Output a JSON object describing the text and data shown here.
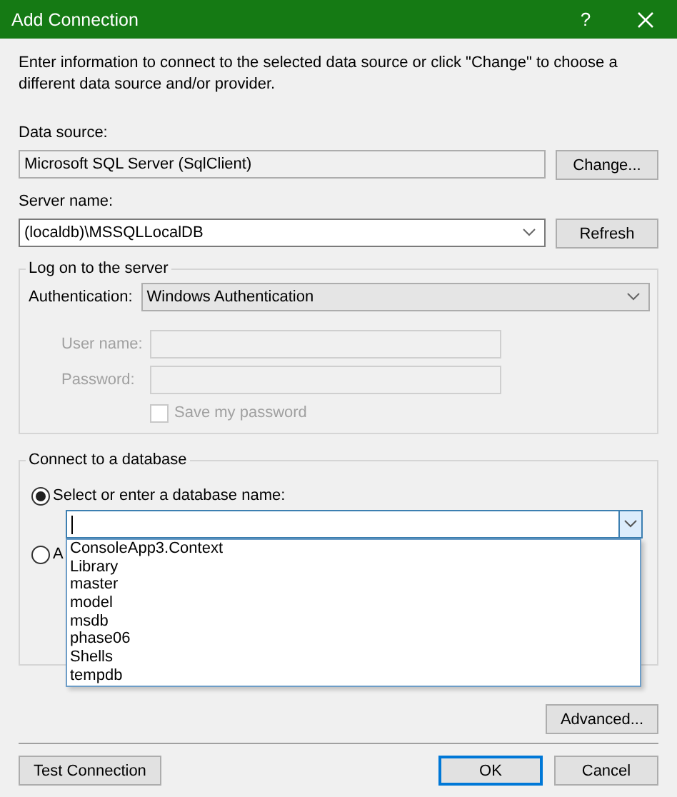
{
  "window": {
    "title": "Add Connection",
    "help": "?"
  },
  "intro": "Enter information to connect to the selected data source or click \"Change\" to choose a different data source and/or provider.",
  "data_source": {
    "label": "Data source:",
    "value": "Microsoft SQL Server (SqlClient)",
    "button": "Change..."
  },
  "server_name": {
    "label": "Server name:",
    "value": "(localdb)\\MSSQLLocalDB",
    "button": "Refresh"
  },
  "logon": {
    "title": "Log on to the server",
    "authentication": {
      "label": "Authentication:",
      "value": "Windows Authentication"
    },
    "fields": [
      {
        "label": "User name:",
        "disabled": true
      },
      {
        "label": "Password:",
        "disabled": true
      }
    ],
    "save_password": {
      "label": "Save my password",
      "checked": false,
      "disabled": true
    }
  },
  "database": {
    "title": "Connect to a database",
    "options": [
      {
        "label": "Select or enter a database name:",
        "selected": true
      },
      {
        "label": "A",
        "selected": false
      }
    ],
    "combo": {
      "expanded": true,
      "items": [
        {
          "label": "ConsoleApp3.Context"
        },
        {
          "label": "Library"
        },
        {
          "label": "master"
        },
        {
          "label": "model"
        },
        {
          "label": "msdb"
        },
        {
          "label": "phase06"
        },
        {
          "label": "Shells"
        },
        {
          "label": "tempdb"
        }
      ]
    }
  },
  "advanced_button": "Advanced...",
  "buttons": [
    {
      "label": "Test Connection",
      "default": false
    },
    {
      "label": "OK",
      "default": true
    },
    {
      "label": "Cancel",
      "default": false
    }
  ]
}
